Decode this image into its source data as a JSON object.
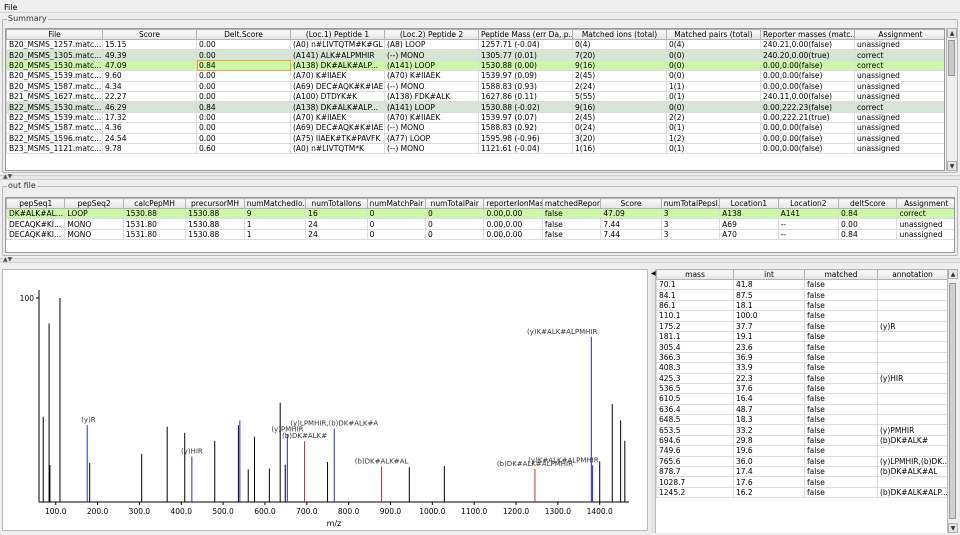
{
  "menu": {
    "file": "File"
  },
  "summary": {
    "title": "Summary",
    "columns": [
      "File",
      "Score",
      "Delt.Score",
      "(Loc.1) Peptide 1",
      "(Loc.2) Peptide 2",
      "Peptide Mass (err Da, p...",
      "Matched ions (total)",
      "Matched pairs (total)",
      "Reporter masses (matc...",
      "Assignment"
    ],
    "rows": [
      [
        "B20_MSMS_1257.matc...",
        "15.15",
        "0.00",
        "(A0) n#LIVTQTM#K#GL",
        "(A8) LOOP",
        "1257.71 (-0.04)",
        "0(4)",
        "0(4)",
        "240.21,0.00(false)",
        "unassigned"
      ],
      [
        "B20_MSMS_1305.matc...",
        "49.39",
        "0.00",
        "(A141) ALK#ALPMHIR",
        "(--) MONO",
        "1305.77 (0.01)",
        "7(20)",
        "0(0)",
        "240.20,0.00(true)",
        "correct"
      ],
      [
        "B20_MSMS_1530.matc...",
        "47.09",
        "0.84",
        "(A138) DK#ALK#ALP...",
        "(A141) LOOP",
        "1530.88 (0.00)",
        "9(16)",
        "0(0)",
        "0.00,0.00(false)",
        "correct"
      ],
      [
        "B20_MSMS_1539.matc...",
        "9.60",
        "0.00",
        "(A70) K#IIAEK",
        "(A70) K#IIAEK",
        "1539.97 (0.09)",
        "2(45)",
        "0(0)",
        "0.00,0.00(false)",
        "unassigned"
      ],
      [
        "B20_MSMS_1587.matc...",
        "4.34",
        "0.00",
        "(A69) DEC#AQK#K#IAEK",
        "(--) MONO",
        "1588.83 (0.93)",
        "2(24)",
        "1(1)",
        "0.00,0.00(false)",
        "unassigned"
      ],
      [
        "B21_MSMS_1627.matc...",
        "22.27",
        "0.00",
        "(A100) DTDYK#K",
        "(A138) FDK#ALK",
        "1627.86 (0.11)",
        "5(55)",
        "0(1)",
        "240.11,0.00(false)",
        "unassigned"
      ],
      [
        "B22_MSMS_1530.matc...",
        "46.29",
        "0.84",
        "(A138) DK#ALK#ALP...",
        "(A141) LOOP",
        "1530.88 (-0.02)",
        "9(16)",
        "0(0)",
        "0.00,222.23(false)",
        "correct"
      ],
      [
        "B22_MSMS_1539.matc...",
        "17.32",
        "0.00",
        "(A70) K#IIAEK",
        "(A70) K#IIAEK",
        "1539.97 (0.07)",
        "2(45)",
        "2(2)",
        "0.00,222.21(true)",
        "unassigned"
      ],
      [
        "B22_MSMS_1587.matc...",
        "4.36",
        "0.00",
        "(A69) DEC#AQK#K#IAEK",
        "(--) MONO",
        "1588.83 (0.92)",
        "0(24)",
        "0(1)",
        "0.00,0.00(false)",
        "unassigned"
      ],
      [
        "B22_MSMS_1596.matc...",
        "24.54",
        "0.00",
        "(A75) IIAEK#TK#PAVFK",
        "(A77) LOOP",
        "1595.98 (-0.96)",
        "3(20)",
        "1(2)",
        "0.00,0.00(false)",
        "unassigned"
      ],
      [
        "B23_MSMS_1121.matc...",
        "9.78",
        "0.60",
        "(A0) n#LIVTQTM*K",
        "(--) MONO",
        "1121.61 (-0.04)",
        "1(16)",
        "0(1)",
        "0.00,0.00(false)",
        "unassigned"
      ]
    ]
  },
  "outfile": {
    "title": "out file",
    "columns": [
      "pepSeq1",
      "pepSeq2",
      "calcPepMH",
      "precursorMH",
      "numMatchedIo...",
      "numTotalIons",
      "numMatchPair",
      "numTotalPair",
      "reporterIonMass",
      "matchedRepor...",
      "Score",
      "numTotalPepsI...",
      "Location1",
      "Location2",
      "deltScore",
      "Assignment"
    ],
    "rows": [
      [
        "DK#ALK#AL...",
        "LOOP",
        "1530.88",
        "1530.88",
        "9",
        "16",
        "0",
        "0",
        "0.00,0.00",
        "false",
        "47.09",
        "3",
        "A138",
        "A141",
        "0.84",
        "correct"
      ],
      [
        "DECAQK#KI...",
        "MONO",
        "1531.80",
        "1530.88",
        "1",
        "24",
        "0",
        "0",
        "0.00,0.00",
        "false",
        "7.44",
        "3",
        "A69",
        "--",
        "0.00",
        "unassigned"
      ],
      [
        "DECAQK#KI...",
        "MONO",
        "1531.80",
        "1530.88",
        "1",
        "24",
        "0",
        "0",
        "0.00,0.00",
        "false",
        "7.44",
        "3",
        "A70",
        "--",
        "0.84",
        "unassigned"
      ]
    ]
  },
  "peaks": {
    "columns": [
      "mass",
      "int",
      "matched",
      "annotation"
    ],
    "rows": [
      [
        "70.1",
        "41.8",
        "false",
        ""
      ],
      [
        "84.1",
        "87.5",
        "false",
        ""
      ],
      [
        "86.1",
        "18.1",
        "false",
        ""
      ],
      [
        "110.1",
        "100.0",
        "false",
        ""
      ],
      [
        "175.2",
        "37.7",
        "false",
        "(y)R"
      ],
      [
        "181.1",
        "19.1",
        "false",
        ""
      ],
      [
        "305.4",
        "23.6",
        "false",
        ""
      ],
      [
        "366.3",
        "36.9",
        "false",
        ""
      ],
      [
        "408.3",
        "33.9",
        "false",
        ""
      ],
      [
        "425.3",
        "22.3",
        "false",
        "(y)HIR"
      ],
      [
        "536.5",
        "37.6",
        "false",
        ""
      ],
      [
        "610.5",
        "16.4",
        "false",
        ""
      ],
      [
        "636.4",
        "48.7",
        "false",
        ""
      ],
      [
        "648.5",
        "18.3",
        "false",
        ""
      ],
      [
        "653.5",
        "33.2",
        "false",
        "(y)PMHIR"
      ],
      [
        "694.6",
        "29.8",
        "false",
        "(b)DK#ALK#"
      ],
      [
        "749.6",
        "19.6",
        "false",
        ""
      ],
      [
        "765.6",
        "36.0",
        "false",
        "(y)LPMHIR,(b)DK..."
      ],
      [
        "878.7",
        "17.4",
        "false",
        "(b)DK#ALK#AL"
      ],
      [
        "1028.7",
        "17.6",
        "false",
        ""
      ],
      [
        "1245.2",
        "16.2",
        "false",
        "(b)DK#ALK#ALP..."
      ]
    ]
  },
  "chart_data": {
    "type": "spectrum",
    "xlabel": "m/z",
    "xlim": [
      60,
      1470
    ],
    "ylim": [
      0,
      100
    ],
    "xticks": [
      "100.0",
      "200.0",
      "300.0",
      "400.0",
      "500.0",
      "600.0",
      "700.0",
      "800.0",
      "900.0",
      "1000.0",
      "1100.0",
      "1200.0",
      "1300.0",
      "1400.0"
    ],
    "xtick_values": [
      100,
      200,
      300,
      400,
      500,
      600,
      700,
      800,
      900,
      1000,
      1100,
      1200,
      1300,
      1400
    ],
    "yticks": [
      "100"
    ],
    "peaks": [
      {
        "x": 70.1,
        "y": 41.8,
        "c": "#000"
      },
      {
        "x": 84.1,
        "y": 87.5,
        "c": "#000"
      },
      {
        "x": 86.1,
        "y": 18.1,
        "c": "#000"
      },
      {
        "x": 110.1,
        "y": 100.0,
        "c": "#000"
      },
      {
        "x": 175.2,
        "y": 37.7,
        "c": "#2a2ad0"
      },
      {
        "x": 181.1,
        "y": 19.1,
        "c": "#000"
      },
      {
        "x": 305.4,
        "y": 23.6,
        "c": "#000"
      },
      {
        "x": 366.3,
        "y": 36.9,
        "c": "#000"
      },
      {
        "x": 408.3,
        "y": 33.9,
        "c": "#000"
      },
      {
        "x": 425.3,
        "y": 22.3,
        "c": "#2a2ad0"
      },
      {
        "x": 480,
        "y": 30,
        "c": "#000"
      },
      {
        "x": 536.5,
        "y": 37.6,
        "c": "#000"
      },
      {
        "x": 540,
        "y": 40,
        "c": "#2a2ad0"
      },
      {
        "x": 560,
        "y": 16,
        "c": "#000"
      },
      {
        "x": 575,
        "y": 32,
        "c": "#000"
      },
      {
        "x": 610.5,
        "y": 16.4,
        "c": "#000"
      },
      {
        "x": 636.4,
        "y": 48.7,
        "c": "#000"
      },
      {
        "x": 648.5,
        "y": 18.3,
        "c": "#000"
      },
      {
        "x": 653.5,
        "y": 33.2,
        "c": "#2a2ad0"
      },
      {
        "x": 694.6,
        "y": 29.8,
        "c": "#c03030"
      },
      {
        "x": 749.6,
        "y": 19.6,
        "c": "#000"
      },
      {
        "x": 765.6,
        "y": 36.0,
        "c": "#2a2ad0"
      },
      {
        "x": 878.7,
        "y": 17.4,
        "c": "#c03030"
      },
      {
        "x": 945,
        "y": 17,
        "c": "#000"
      },
      {
        "x": 1028.7,
        "y": 17.6,
        "c": "#000"
      },
      {
        "x": 1245.2,
        "y": 16.2,
        "c": "#c03030"
      },
      {
        "x": 1380,
        "y": 81,
        "c": "#2a2ad0"
      },
      {
        "x": 1383,
        "y": 18,
        "c": "#2a2ad0"
      },
      {
        "x": 1400,
        "y": 20,
        "c": "#000"
      },
      {
        "x": 1430,
        "y": 48,
        "c": "#000"
      },
      {
        "x": 1450,
        "y": 40,
        "c": "#000"
      },
      {
        "x": 1460,
        "y": 30,
        "c": "#000"
      }
    ],
    "labels": [
      {
        "x": 175.2,
        "y": 37.7,
        "t": "(y)R"
      },
      {
        "x": 425.3,
        "y": 22.3,
        "t": "(y)HIR"
      },
      {
        "x": 653.5,
        "y": 33.2,
        "t": "(y)PMHIR"
      },
      {
        "x": 694.6,
        "y": 29.8,
        "t": "(b)DK#ALK#"
      },
      {
        "x": 765.6,
        "y": 36.0,
        "t": "(y)LPMHIR,(b)DK#ALK#A"
      },
      {
        "x": 878.7,
        "y": 17.4,
        "t": "(b)DK#ALK#AL"
      },
      {
        "x": 1245.2,
        "y": 16.2,
        "t": "(b)DK#ALK#ALPMHIR"
      },
      {
        "x": 1383,
        "y": 18,
        "t": "(y)K#ALK#ALPMHIR"
      },
      {
        "x": 1380,
        "y": 81,
        "t": "(y)K#ALK#ALPMHIR"
      }
    ]
  }
}
